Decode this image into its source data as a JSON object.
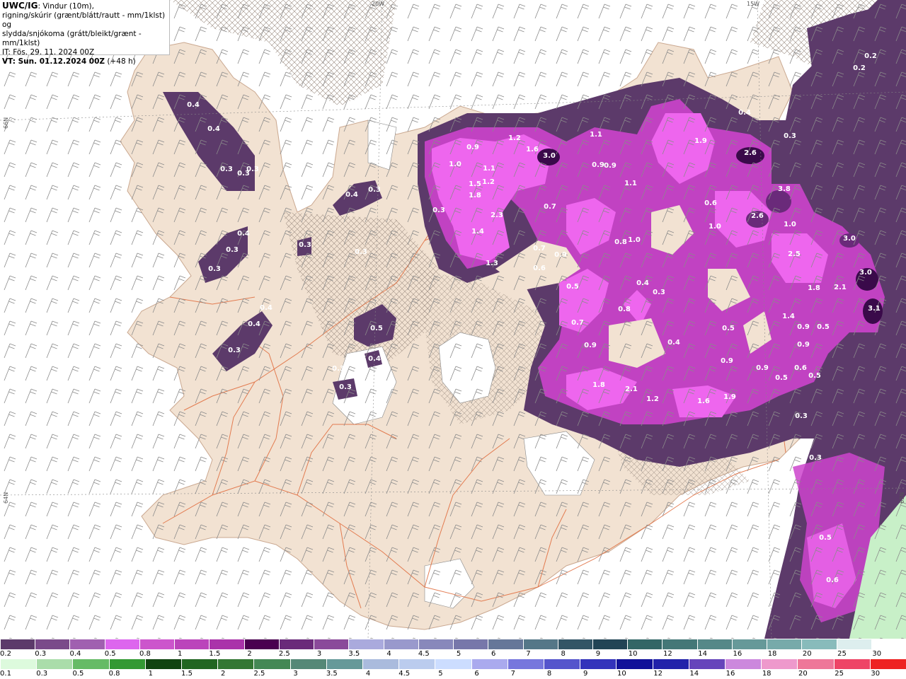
{
  "info": {
    "model": "UWC/IG",
    "line1": ": Vindur (10m),",
    "line2": "rigning/skúrir (grænt/blátt/rautt - mm/1klst) og",
    "line3": "slydda/snjókoma (grátt/bleikt/grænt - mm/1klst)",
    "it": "IT: Fös. 29. 11. 2024 00Z",
    "vt": "VT: Sun. 01.12.2024 00Z",
    "lead": " (+48 h)"
  },
  "graticule": {
    "lon_top_1": "20W",
    "lon_top_2": "15W",
    "lat_left_1": "66N",
    "lat_left_2": "64N",
    "lat_right_1": "65N"
  },
  "map_values": [
    "0.2",
    "0.2",
    "0.3",
    "0.4",
    "0.4",
    "0.3",
    "0.3",
    "0.3",
    "0.4",
    "0.3",
    "0.4",
    "0.3",
    "0.3",
    "0.3",
    "0.3",
    "0.4",
    "0.4",
    "0.3",
    "0.5",
    "0.4",
    "0.3",
    "0.3",
    "0.9",
    "1.0",
    "1.5",
    "1.8",
    "1.2",
    "1.1",
    "1.6",
    "1.2",
    "3.0",
    "0.3",
    "1.4",
    "2.3",
    "1.3",
    "0.7",
    "0.7",
    "0.6",
    "0.9",
    "0.5",
    "1.1",
    "0.9",
    "0.9",
    "1.1",
    "0.8",
    "1.0",
    "0.4",
    "0.3",
    "0.8",
    "0.7",
    "0.9",
    "1.9",
    "2.6",
    "3.8",
    "2.6",
    "0.6",
    "1.0",
    "1.0",
    "2.5",
    "3.0",
    "3.0",
    "3.1",
    "1.8",
    "2.1",
    "1.4",
    "0.9",
    "0.5",
    "0.9",
    "0.5",
    "0.9",
    "0.6",
    "0.5",
    "0.5",
    "0.4",
    "0.9",
    "1.8",
    "2.1",
    "1.2",
    "1.6",
    "1.9",
    "0.3",
    "0.3",
    "0.5",
    "0.6",
    "0.3",
    "0.4"
  ],
  "colors": {
    "land": "#f2e2d2",
    "roads": "#e06a3a",
    "precip_light": "#5c3a6a",
    "precip_mid": "#cc44cc",
    "precip_heavy": "#ee66ee",
    "precip_peak": "#3a0a4a",
    "rain_green": "#c8f0c8"
  },
  "legend": {
    "snow_labels": [
      "0.2",
      "0.3",
      "0.4",
      "0.5",
      "0.8",
      "1",
      "1.5",
      "2",
      "2.5",
      "3",
      "3.5",
      "4",
      "4.5",
      "5",
      "6",
      "7",
      "8",
      "9",
      "10",
      "12",
      "14",
      "16",
      "18",
      "20",
      "25",
      "30"
    ],
    "snow_colors": [
      "#5c3a6a",
      "#7a4a8a",
      "#a060b0",
      "#dd66ee",
      "#cc55cc",
      "#bb44bb",
      "#aa33aa",
      "#4a0050",
      "#6a2a7a",
      "#8a4a9a",
      "#aaaadd",
      "#9999cc",
      "#8888bb",
      "#7777aa",
      "#667799",
      "#557788",
      "#335566",
      "#224455",
      "#336666",
      "#447777",
      "#558888",
      "#669999",
      "#77aaaa",
      "#88bbbb",
      "#ddeeee",
      "#ffffff"
    ],
    "rain_labels": [
      "0.1",
      "0.3",
      "0.5",
      "0.8",
      "1",
      "1.5",
      "2",
      "2.5",
      "3",
      "3.5",
      "4",
      "4.5",
      "5",
      "6",
      "7",
      "8",
      "9",
      "10",
      "12",
      "14",
      "16",
      "18",
      "20",
      "25",
      "30"
    ],
    "rain_colors": [
      "#ddfadd",
      "#aaddaa",
      "#66bb66",
      "#339933",
      "#114411",
      "#226622",
      "#337733",
      "#448855",
      "#558877",
      "#669999",
      "#aabbdd",
      "#bbccee",
      "#ccddff",
      "#aaaaee",
      "#7777dd",
      "#5555cc",
      "#3333bb",
      "#111199",
      "#2222aa",
      "#6644bb",
      "#cc88dd",
      "#ee99cc",
      "#ee7799",
      "#ee4466",
      "#ee2222"
    ]
  }
}
